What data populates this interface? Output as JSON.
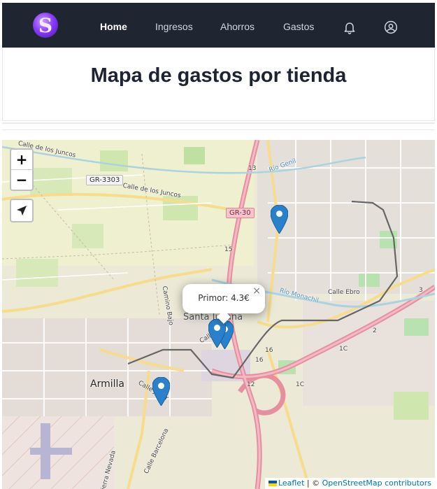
{
  "nav": {
    "logo_letter": "S",
    "links": [
      "Home",
      "Ingresos",
      "Ahorros",
      "Gastos"
    ],
    "active": "Home",
    "icons": [
      "bell-icon",
      "user-icon"
    ]
  },
  "page": {
    "title": "Mapa de gastos por tienda"
  },
  "map": {
    "zoom_in": "+",
    "zoom_out": "−",
    "locate_icon": "location-arrow-icon",
    "labels": {
      "calle_juncos_1": "Calle de los Juncos",
      "calle_juncos_2": "Calle de los Juncos",
      "gr3303": "GR-3303",
      "gr30": "GR-30",
      "rio_genil": "Río Genil",
      "rio_monachil": "Río Monachil",
      "calle_ebro": "Calle Ebro",
      "camino_bajo": "Camino Bajo",
      "santa_juliana": "Santa Juliana",
      "armilla": "Armilla",
      "calle_jucar": "Calle Júcar",
      "calle_barcelona": "Calle Barcelona",
      "sierra_nevada": "Sierra Nevada",
      "calle_short": "Calle",
      "km13": "13",
      "km15": "15",
      "km16a": "16",
      "km16b": "16",
      "km12": "12",
      "km1c": "1C",
      "km1c2": "1C",
      "km2": "2",
      "km3": "3"
    },
    "popup": {
      "text": "Primor: 4.3€",
      "close": "×"
    },
    "markers": [
      "marker-1",
      "marker-2",
      "marker-3",
      "marker-4"
    ],
    "attribution": {
      "leaflet": "Leaflet",
      "separator": " | © ",
      "osm": "OpenStreetMap contributors"
    }
  },
  "colors": {
    "navbar": "#1f2632",
    "marker": "#2a81cb",
    "motorway": "#e892a2",
    "primary_road": "#fcd6a4"
  }
}
